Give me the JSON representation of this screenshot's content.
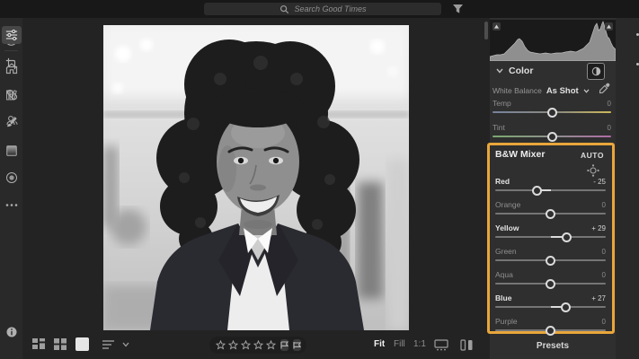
{
  "topbar": {
    "search_placeholder": "Search Good Times"
  },
  "sidebar": {
    "icons": [
      "add-photos",
      "home",
      "library",
      "people"
    ]
  },
  "viewer": {
    "zoom_modes": [
      {
        "label": "Fit",
        "active": true
      },
      {
        "label": "Fill",
        "active": false
      },
      {
        "label": "1:1",
        "active": false
      }
    ],
    "rating_stars": 5
  },
  "panel": {
    "color": {
      "title": "Color",
      "white_balance_label": "White Balance",
      "white_balance_value": "As Shot",
      "sliders": [
        {
          "label": "Temp",
          "value": "0",
          "num": 0,
          "active": false
        },
        {
          "label": "Tint",
          "value": "0",
          "num": 0,
          "active": false
        }
      ]
    },
    "bw_mixer": {
      "title": "B&W Mixer",
      "auto_label": "AUTO",
      "highlight_color": "#E9A63B",
      "sliders": [
        {
          "label": "Red",
          "value": "- 25",
          "num": -25,
          "active": true
        },
        {
          "label": "Orange",
          "value": "0",
          "num": 0,
          "active": false
        },
        {
          "label": "Yellow",
          "value": "+ 29",
          "num": 29,
          "active": true
        },
        {
          "label": "Green",
          "value": "0",
          "num": 0,
          "active": false
        },
        {
          "label": "Aqua",
          "value": "0",
          "num": 0,
          "active": false
        },
        {
          "label": "Blue",
          "value": "+ 27",
          "num": 27,
          "active": true
        },
        {
          "label": "Purple",
          "value": "0",
          "num": 0,
          "active": false
        }
      ]
    },
    "presets_label": "Presets"
  },
  "tool_rail": {
    "items": [
      "edit",
      "crop",
      "healing",
      "brush",
      "linear-gradient",
      "radial-gradient",
      "more",
      "info"
    ]
  }
}
